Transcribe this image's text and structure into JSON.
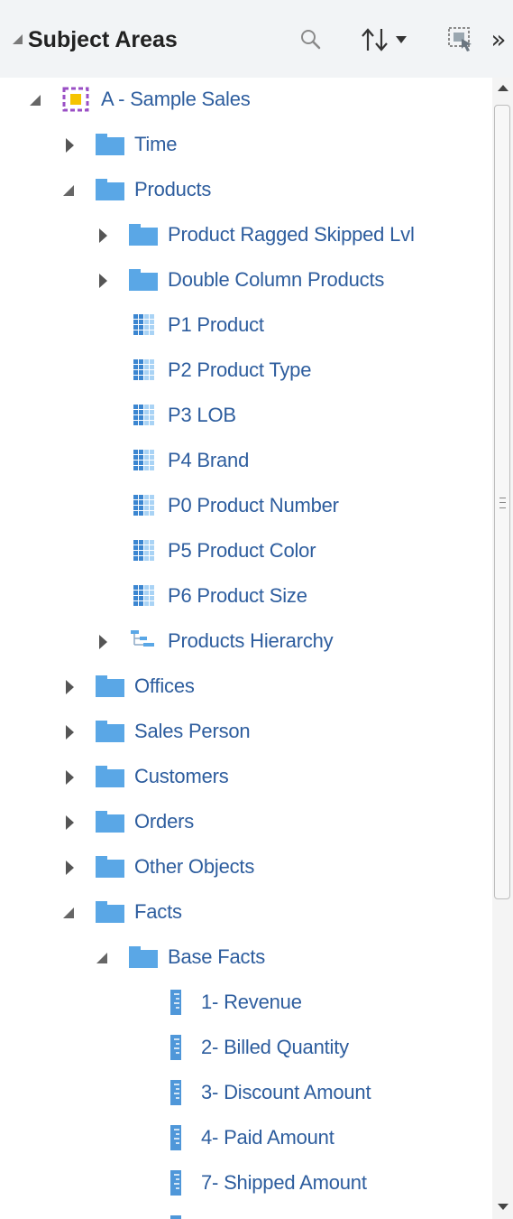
{
  "header": {
    "title": "Subject Areas",
    "more_glyph": "»",
    "icons": {
      "collapse": "collapse-triangle-icon",
      "search": "search-icon",
      "sort": "sort-icon",
      "select": "select-columns-icon",
      "more": "double-chevron-right-icon"
    }
  },
  "colors": {
    "label": "#2d5d9e",
    "folder": "#5aa7e6",
    "column_dark": "#3b86d1",
    "column_light": "#a9d3f5",
    "measure": "#4f97d9",
    "subject_area_border": "#9a4fc5",
    "subject_area_fill": "#f5c400",
    "header_bg": "#f2f4f6"
  },
  "tree": [
    {
      "label": "A - Sample Sales",
      "level": 0,
      "toggle": "expanded",
      "icon": "subject-area"
    },
    {
      "label": "Time",
      "level": 1,
      "toggle": "collapsed",
      "icon": "folder"
    },
    {
      "label": "Products",
      "level": 1,
      "toggle": "expanded",
      "icon": "folder"
    },
    {
      "label": "Product Ragged Skipped Lvl",
      "level": 2,
      "toggle": "collapsed",
      "icon": "folder"
    },
    {
      "label": "Double Column Products",
      "level": 2,
      "toggle": "collapsed",
      "icon": "folder"
    },
    {
      "label": "P1 Product",
      "level": 2,
      "toggle": "none",
      "icon": "column"
    },
    {
      "label": "P2 Product Type",
      "level": 2,
      "toggle": "none",
      "icon": "column"
    },
    {
      "label": "P3 LOB",
      "level": 2,
      "toggle": "none",
      "icon": "column"
    },
    {
      "label": "P4 Brand",
      "level": 2,
      "toggle": "none",
      "icon": "column"
    },
    {
      "label": "P0 Product Number",
      "level": 2,
      "toggle": "none",
      "icon": "column"
    },
    {
      "label": "P5 Product Color",
      "level": 2,
      "toggle": "none",
      "icon": "column"
    },
    {
      "label": "P6 Product Size",
      "level": 2,
      "toggle": "none",
      "icon": "column"
    },
    {
      "label": "Products Hierarchy",
      "level": 2,
      "toggle": "collapsed",
      "icon": "hierarchy"
    },
    {
      "label": "Offices",
      "level": 1,
      "toggle": "collapsed",
      "icon": "folder"
    },
    {
      "label": "Sales Person",
      "level": 1,
      "toggle": "collapsed",
      "icon": "folder"
    },
    {
      "label": "Customers",
      "level": 1,
      "toggle": "collapsed",
      "icon": "folder"
    },
    {
      "label": "Orders",
      "level": 1,
      "toggle": "collapsed",
      "icon": "folder"
    },
    {
      "label": "Other Objects",
      "level": 1,
      "toggle": "collapsed",
      "icon": "folder"
    },
    {
      "label": "Facts",
      "level": 1,
      "toggle": "expanded",
      "icon": "folder"
    },
    {
      "label": "Base Facts",
      "level": 2,
      "toggle": "expanded",
      "icon": "folder"
    },
    {
      "label": "1- Revenue",
      "level": 3,
      "toggle": "none",
      "icon": "measure"
    },
    {
      "label": "2- Billed Quantity",
      "level": 3,
      "toggle": "none",
      "icon": "measure"
    },
    {
      "label": "3- Discount Amount",
      "level": 3,
      "toggle": "none",
      "icon": "measure"
    },
    {
      "label": "4- Paid Amount",
      "level": 3,
      "toggle": "none",
      "icon": "measure"
    },
    {
      "label": "7- Shipped Amount",
      "level": 3,
      "toggle": "none",
      "icon": "measure"
    },
    {
      "label": "",
      "level": 3,
      "toggle": "none",
      "icon": "measure"
    }
  ]
}
